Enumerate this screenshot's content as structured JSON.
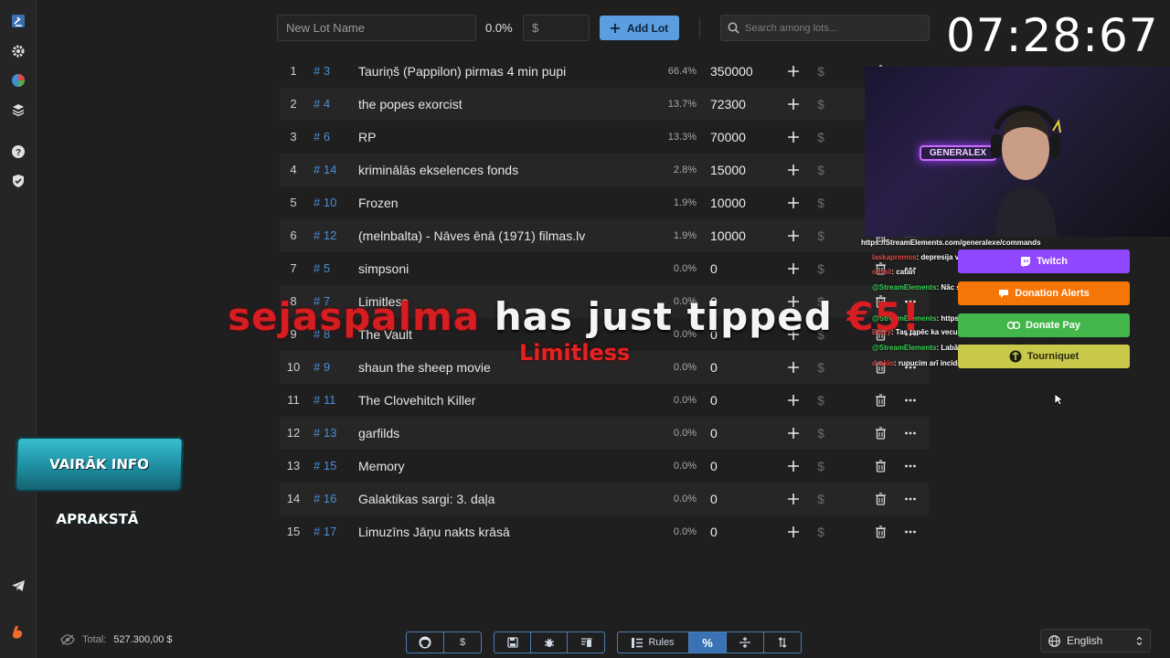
{
  "toolbar": {
    "lot_name_placeholder": "New Lot Name",
    "percent": "0.0%",
    "amount_placeholder": "$",
    "add_lot_label": "Add Lot",
    "search_placeholder": "Search among lots..."
  },
  "lots": [
    {
      "idx": "1",
      "id": "# 3",
      "name": "Tauriņš (Pappilon) pirmas 4 min pupi",
      "pct": "66.4%",
      "amount": "350000"
    },
    {
      "idx": "2",
      "id": "# 4",
      "name": "the popes exorcist",
      "pct": "13.7%",
      "amount": "72300"
    },
    {
      "idx": "3",
      "id": "# 6",
      "name": "RP",
      "pct": "13.3%",
      "amount": "70000"
    },
    {
      "idx": "4",
      "id": "# 14",
      "name": "kriminālās ekselences fonds",
      "pct": "2.8%",
      "amount": "15000"
    },
    {
      "idx": "5",
      "id": "# 10",
      "name": "Frozen",
      "pct": "1.9%",
      "amount": "10000"
    },
    {
      "idx": "6",
      "id": "# 12",
      "name": "(melnbalta) - Nāves ēnā (1971) filmas.lv",
      "pct": "1.9%",
      "amount": "10000"
    },
    {
      "idx": "7",
      "id": "# 5",
      "name": "simpsoni",
      "pct": "0.0%",
      "amount": "0"
    },
    {
      "idx": "8",
      "id": "# 7",
      "name": "Limitless",
      "pct": "0.0%",
      "amount": "0"
    },
    {
      "idx": "9",
      "id": "# 8",
      "name": "The Vault",
      "pct": "0.0%",
      "amount": "0"
    },
    {
      "idx": "10",
      "id": "# 9",
      "name": "shaun the sheep movie",
      "pct": "0.0%",
      "amount": "0"
    },
    {
      "idx": "11",
      "id": "# 11",
      "name": "The Clovehitch Killer",
      "pct": "0.0%",
      "amount": "0"
    },
    {
      "idx": "12",
      "id": "# 13",
      "name": "garfilds",
      "pct": "0.0%",
      "amount": "0"
    },
    {
      "idx": "13",
      "id": "# 15",
      "name": "Memory",
      "pct": "0.0%",
      "amount": "0"
    },
    {
      "idx": "14",
      "id": "# 16",
      "name": "Galaktikas sargi: 3. daļa",
      "pct": "0.0%",
      "amount": "0"
    },
    {
      "idx": "15",
      "id": "# 17",
      "name": "Limuzīns Jāņu nakts krāsā",
      "pct": "0.0%",
      "amount": "0"
    }
  ],
  "row_dollar": "$",
  "overlay": {
    "clock": "07:28:67",
    "neon_sign": "GENERALEX",
    "chat_url": "https://StreamElements.com/generalexe/commands",
    "chat": [
      {
        "nick": "laskapremss",
        "text": ": depresija vinam"
      },
      {
        "nick": "omoil",
        "text": ": catan"
      },
      {
        "nick": "@StreamElements",
        "text": ": Nāc spēlēt katanu! https://pioneers.game/"
      },
      {
        "nick": "@StreamElements",
        "text": ": https://generalexe.com/leaderboard/skinrave"
      },
      {
        "nick": "Blazy",
        "text": ": Tas tapēc ka vecums!!!"
      },
      {
        "nick": "@StreamElements",
        "text": ": Labākā vieta kur macīties https://www.augstskola.lv/"
      },
      {
        "nick": "drakio",
        "text": ": rupucim arī incidenti"
      }
    ],
    "stream_buttons": [
      "Twitch",
      "Donation Alerts",
      "Donate Pay",
      "Tourniquet"
    ],
    "tip_user": "sejaspalma",
    "tip_text": "has just tipped",
    "tip_amount": "€5!",
    "tip_message": "Limitless",
    "banner": "VAIRĀK INFO APRAKSTĀ"
  },
  "footer": {
    "total_label": "Total:",
    "total_value": "527.300,00 $",
    "dollar_label": "$",
    "rules_label": "Rules",
    "percent_label": "%",
    "language": "English"
  },
  "colors": {
    "background": "#1f1f1f",
    "accent": "#5a9ee0",
    "lot_id": "#4a8fd6",
    "twitch": "#9146ff",
    "donation_alerts": "#f57507",
    "donate_pay": "#43b649",
    "tourniquet": "#c8c94a",
    "tip_red": "#d51d22"
  }
}
